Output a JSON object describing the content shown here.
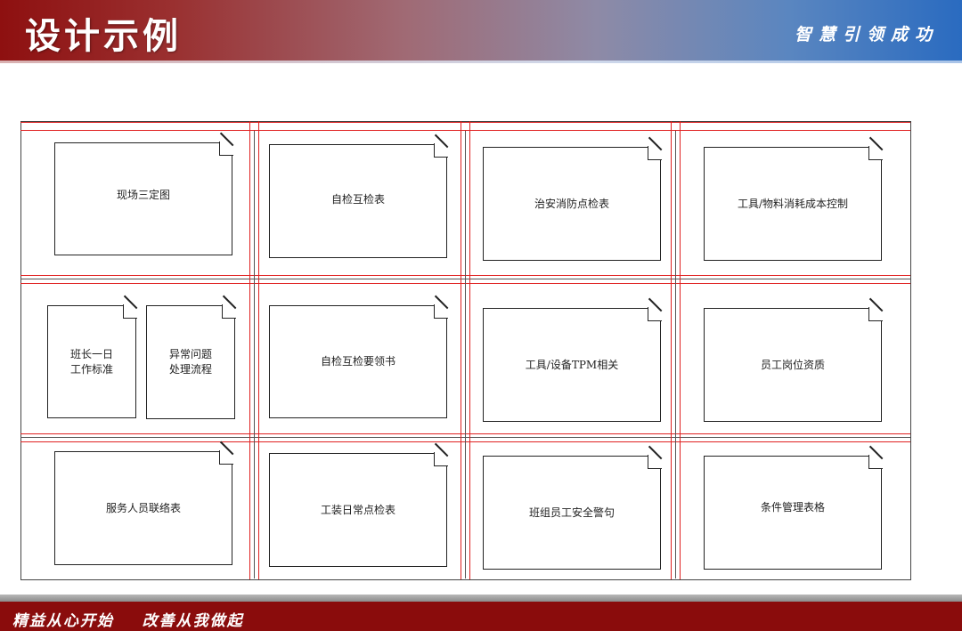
{
  "header": {
    "title": "设计示例",
    "slogan": "智慧引领成功"
  },
  "cells": {
    "r1c1": "现场三定图",
    "r1c2": "自检互检表",
    "r1c3": "治安消防点检表",
    "r1c4": "工具/物料消耗成本控制",
    "r2c1a": "班长一日\n工作标准",
    "r2c1b": "异常问题\n处理流程",
    "r2c2": "自检互检要领书",
    "r2c3": "工具/设备TPM相关",
    "r2c4": "员工岗位资质",
    "r3c1": "服务人员联络表",
    "r3c2": "工装日常点检表",
    "r3c3": "班组员工安全警句",
    "r3c4": "条件管理表格"
  },
  "footer": {
    "slogan": "精益从心开始    改善从我做起"
  },
  "colors": {
    "header_red": "#8e1010",
    "header_blue": "#2a6bc0",
    "grid_red": "#e02020",
    "footer_red": "#8a0c0c"
  }
}
